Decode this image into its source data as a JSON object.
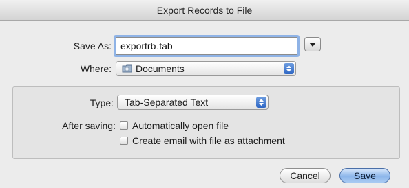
{
  "window": {
    "title": "Export Records to File"
  },
  "save_as": {
    "label": "Save As:",
    "value_before_caret": "exportrb",
    "value_after_caret": ".tab",
    "expand_icon": "disclosure-triangle-icon"
  },
  "where": {
    "label": "Where:",
    "selected": "Documents",
    "folder_icon": "folder-icon"
  },
  "type": {
    "label": "Type:",
    "selected": "Tab-Separated Text"
  },
  "after_saving": {
    "label": "After saving:",
    "options": [
      {
        "label": "Automatically open file",
        "checked": false
      },
      {
        "label": "Create email with file as attachment",
        "checked": false
      }
    ]
  },
  "buttons": {
    "cancel": "Cancel",
    "save": "Save"
  },
  "colors": {
    "focus_ring": "#8fb3e6",
    "default_button": "#8cb6ea",
    "stepper": "#2e66c4"
  }
}
